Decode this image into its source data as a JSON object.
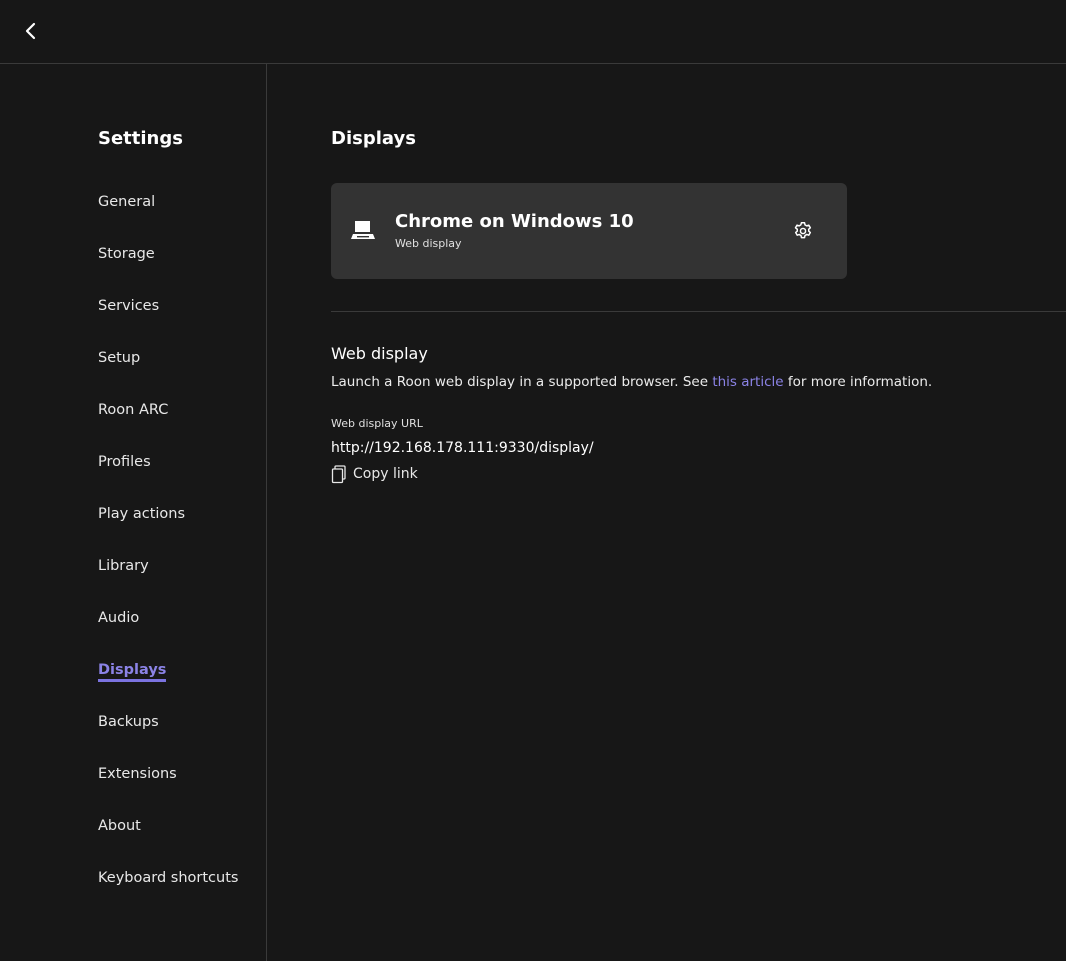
{
  "sidebar": {
    "title": "Settings",
    "items": [
      {
        "label": "General",
        "active": false
      },
      {
        "label": "Storage",
        "active": false
      },
      {
        "label": "Services",
        "active": false
      },
      {
        "label": "Setup",
        "active": false
      },
      {
        "label": "Roon ARC",
        "active": false
      },
      {
        "label": "Profiles",
        "active": false
      },
      {
        "label": "Play actions",
        "active": false
      },
      {
        "label": "Library",
        "active": false
      },
      {
        "label": "Audio",
        "active": false
      },
      {
        "label": "Displays",
        "active": true
      },
      {
        "label": "Backups",
        "active": false
      },
      {
        "label": "Extensions",
        "active": false
      },
      {
        "label": "About",
        "active": false
      },
      {
        "label": "Keyboard shortcuts",
        "active": false
      }
    ]
  },
  "main": {
    "title": "Displays",
    "display_card": {
      "name": "Chrome on Windows 10",
      "type": "Web display",
      "icon": "laptop-icon",
      "action_icon": "gear-icon"
    },
    "web_display": {
      "title": "Web display",
      "desc_before": "Launch a Roon web display in a supported browser. See ",
      "link_text": "this article",
      "desc_after": " for more information.",
      "url_label": "Web display URL",
      "url": "http://192.168.178.111:9330/display/",
      "copy_label": "Copy link",
      "copy_icon": "copy-icon"
    }
  },
  "colors": {
    "background": "#171717",
    "card": "#333333",
    "accent": "#8b83e6",
    "divider": "#3a3a3a"
  }
}
